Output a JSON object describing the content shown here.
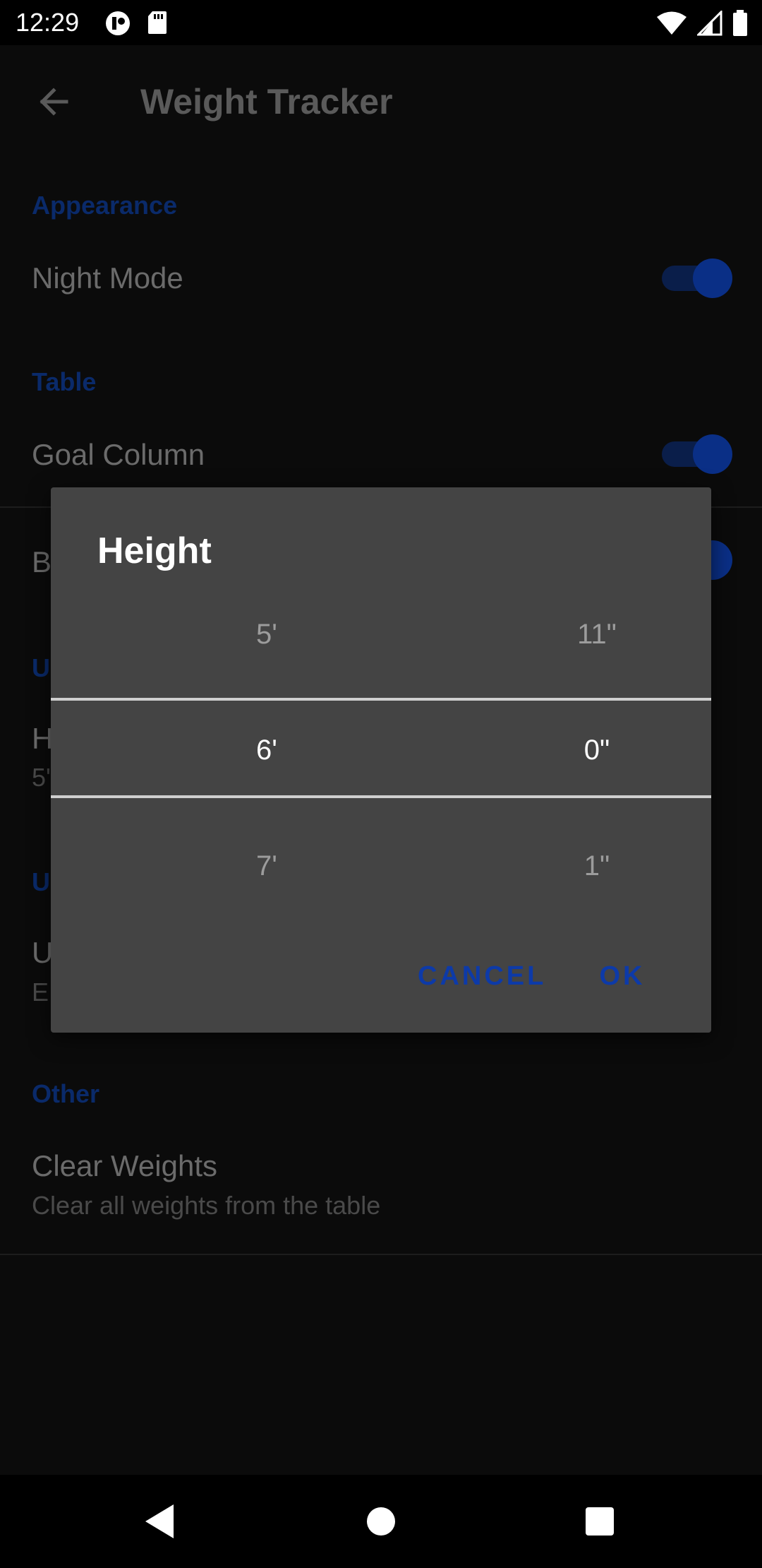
{
  "status_bar": {
    "time": "12:29"
  },
  "app_bar": {
    "title": "Weight Tracker"
  },
  "settings": {
    "appearance_header": "Appearance",
    "night_mode_label": "Night Mode",
    "table_header": "Table",
    "goal_column_label": "Goal Column",
    "bmi_label_partial": "B",
    "units_header_partial": "U",
    "height_label_partial": "H",
    "height_value_partial": "5'",
    "units2_header_partial": "U",
    "units2_label_partial": "U",
    "units2_value_partial": "E",
    "other_header": "Other",
    "clear_weights_label": "Clear Weights",
    "clear_weights_summary": "Clear all weights from the table"
  },
  "dialog": {
    "title": "Height",
    "feet": {
      "above": "5'",
      "selected": "6'",
      "below": "7'"
    },
    "inches": {
      "above": "11\"",
      "selected": "0\"",
      "below": "1\""
    },
    "cancel_label": "CANCEL",
    "ok_label": "OK"
  },
  "colors": {
    "accent": "#0d3aa8",
    "dialog_bg": "#444444",
    "scrim_bg": "#0b0b0b"
  },
  "icons": {
    "back": "arrow-left-icon",
    "status_left": [
      "media-icon",
      "sd-card-icon"
    ],
    "status_right": [
      "wifi-icon",
      "signal-icon",
      "battery-icon"
    ],
    "nav": [
      "back-triangle-icon",
      "home-circle-icon",
      "recents-square-icon"
    ]
  }
}
